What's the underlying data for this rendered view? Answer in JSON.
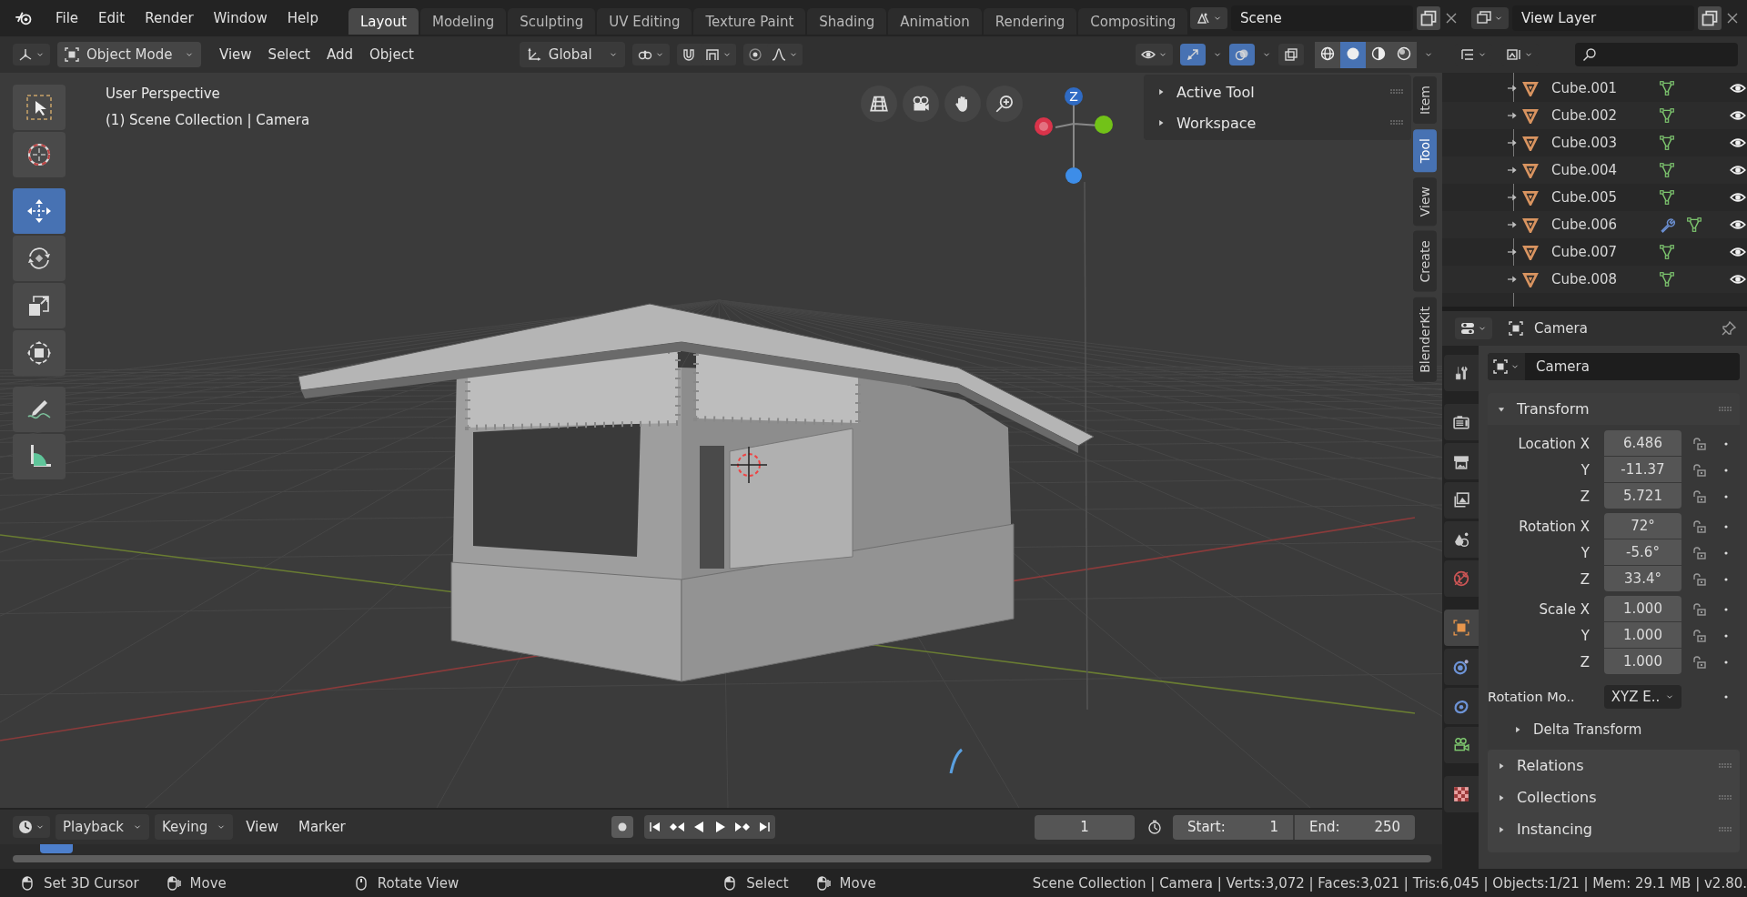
{
  "menu": [
    "File",
    "Edit",
    "Render",
    "Window",
    "Help"
  ],
  "workspaces": [
    {
      "label": "Layout",
      "selected": true
    },
    {
      "label": "Modeling",
      "selected": false
    },
    {
      "label": "Sculpting",
      "selected": false
    },
    {
      "label": "UV Editing",
      "selected": false
    },
    {
      "label": "Texture Paint",
      "selected": false
    },
    {
      "label": "Shading",
      "selected": false
    },
    {
      "label": "Animation",
      "selected": false
    },
    {
      "label": "Rendering",
      "selected": false
    },
    {
      "label": "Compositing",
      "selected": false
    }
  ],
  "scene": "Scene",
  "view_layer": "View Layer",
  "viewport_header": {
    "mode": "Object Mode",
    "menus": [
      "View",
      "Select",
      "Add",
      "Object"
    ],
    "orientation": "Global",
    "toggles": [
      {
        "kind": "gizmos",
        "on": true
      },
      {
        "kind": "overlays",
        "on": true
      },
      {
        "kind": "xray",
        "on": false
      }
    ],
    "shading": [
      {
        "kind": "wireframe",
        "selected": false
      },
      {
        "kind": "solid",
        "selected": true
      },
      {
        "kind": "material",
        "selected": false
      },
      {
        "kind": "rendered",
        "selected": false
      }
    ]
  },
  "tools": [
    {
      "kind": "select",
      "selected": false
    },
    {
      "kind": "cursor",
      "selected": false
    },
    {
      "kind": "move",
      "selected": true
    },
    {
      "kind": "rotate",
      "selected": false
    },
    {
      "kind": "scale",
      "selected": false
    },
    {
      "kind": "transform",
      "selected": false
    },
    {
      "kind": "annotate",
      "selected": false
    },
    {
      "kind": "measure",
      "selected": false
    }
  ],
  "overlay": {
    "view": "User Perspective",
    "context": "(1) Scene Collection | Camera"
  },
  "gizmo": {
    "label": "Z"
  },
  "sidebar_panels": [
    {
      "label": "Active Tool",
      "expanded": false
    },
    {
      "label": "Workspace",
      "expanded": false
    }
  ],
  "sidebar_tabs": [
    {
      "label": "Item",
      "selected": false
    },
    {
      "label": "Tool",
      "selected": true
    },
    {
      "label": "View",
      "selected": false
    },
    {
      "label": "Create",
      "selected": false
    },
    {
      "label": "BlenderKit",
      "selected": false
    }
  ],
  "outliner": [
    {
      "name": "Cube.001",
      "modifier": false
    },
    {
      "name": "Cube.002",
      "modifier": false
    },
    {
      "name": "Cube.003",
      "modifier": false
    },
    {
      "name": "Cube.004",
      "modifier": false
    },
    {
      "name": "Cube.005",
      "modifier": false
    },
    {
      "name": "Cube.006",
      "modifier": true
    },
    {
      "name": "Cube.007",
      "modifier": false
    },
    {
      "name": "Cube.008",
      "modifier": false
    }
  ],
  "properties": {
    "title": "Camera",
    "object_name": "Camera",
    "tabs": [
      {
        "kind": "tool",
        "selected": false
      },
      {
        "kind": "render",
        "selected": false
      },
      {
        "kind": "output",
        "selected": false
      },
      {
        "kind": "view-layer",
        "selected": false
      },
      {
        "kind": "scene",
        "selected": false
      },
      {
        "kind": "world",
        "selected": false
      },
      {
        "kind": "object",
        "selected": true
      },
      {
        "kind": "physics",
        "selected": false
      },
      {
        "kind": "constraints",
        "selected": false
      },
      {
        "kind": "camera-data",
        "selected": false
      },
      {
        "kind": "texture",
        "selected": false
      }
    ],
    "transform": {
      "label": "Transform",
      "expanded": true,
      "groups": [
        [
          {
            "label": "Location X",
            "value": "6.486"
          },
          {
            "label": "Y",
            "value": "-11.37"
          },
          {
            "label": "Z",
            "value": "5.721"
          }
        ],
        [
          {
            "label": "Rotation X",
            "value": "72°"
          },
          {
            "label": "Y",
            "value": "-5.6°"
          },
          {
            "label": "Z",
            "value": "33.4°"
          }
        ],
        [
          {
            "label": "Scale X",
            "value": "1.000"
          },
          {
            "label": "Y",
            "value": "1.000"
          },
          {
            "label": "Z",
            "value": "1.000"
          }
        ]
      ],
      "rotation_mode": {
        "label": "Rotation Mo..",
        "value": "XYZ E.."
      },
      "subpanel": {
        "label": "Delta Transform",
        "expanded": false
      }
    },
    "panels": [
      {
        "label": "Relations",
        "expanded": false
      },
      {
        "label": "Collections",
        "expanded": false
      },
      {
        "label": "Instancing",
        "expanded": false
      }
    ]
  },
  "timeline": {
    "menus": [
      "Playback",
      "Keying",
      "View",
      "Marker"
    ],
    "current_frame": "1",
    "start_label": "Start:",
    "start": "1",
    "end_label": "End:",
    "end": "250"
  },
  "status_bar": {
    "hints": [
      {
        "kind": "mouse-left",
        "label": "Set 3D Cursor"
      },
      {
        "kind": "mouse-drag",
        "label": "Move"
      },
      {
        "kind": "mouse-middle",
        "label": "Rotate View"
      },
      {
        "kind": "mouse-left",
        "label": "Select"
      },
      {
        "kind": "mouse-drag",
        "label": "Move"
      }
    ],
    "stats": "Scene Collection | Camera | Verts:3,072 | Faces:3,021 | Tris:6,045 | Objects:1/21 | Mem: 29.1 MB | v2.80."
  }
}
